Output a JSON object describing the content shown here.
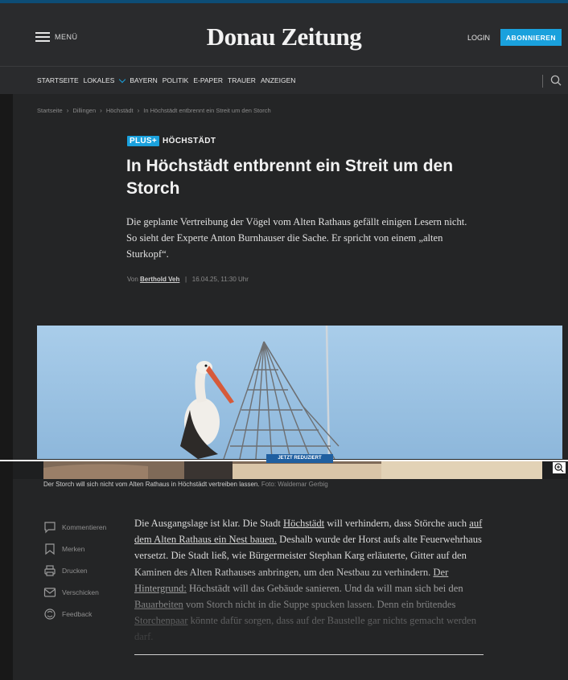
{
  "header": {
    "menu_label": "MENÜ",
    "logo": "Donau Zeitung",
    "login_label": "LOGIN",
    "subscribe_label": "ABONNIEREN",
    "accent_color": "#1aa1dd",
    "nav": [
      "STARTSEITE",
      "LOKALES",
      "BAYERN",
      "POLITIK",
      "E-PAPER",
      "TRAUER",
      "ANZEIGEN"
    ]
  },
  "breadcrumb": [
    "Startseite",
    "Dillingen",
    "Höchstädt",
    "In Höchstädt entbrennt ein Streit um den Storch"
  ],
  "article": {
    "plus_badge": "PLUS+",
    "kicker": "HÖCHSTÄDT",
    "headline": "In Höchstädt entbrennt ein Streit um den Storch",
    "lead": "Die geplante Vertreibung der Vögel vom Alten Rathaus gefällt einigen Lesern nicht. So sieht der Experte Anton Burnhauser die Sache. Er spricht von einem „alten Sturkopf“.",
    "byline_prefix": "Von",
    "author": "Berthold Veh",
    "byline_sep": "|",
    "date": "16.04.25, 11:30 Uhr",
    "image_overlay_label": "JETZT REDUZIERT",
    "caption": "Der Storch will sich nicht vom Alten Rathaus in Höchstädt vertreiben lassen.",
    "photo_credit": "Foto: Waldemar Gerbig"
  },
  "actions": [
    {
      "label": "Kommentieren",
      "icon": "comment-icon"
    },
    {
      "label": "Merken",
      "icon": "bookmark-icon"
    },
    {
      "label": "Drucken",
      "icon": "print-icon"
    },
    {
      "label": "Verschicken",
      "icon": "mail-icon"
    },
    {
      "label": "Feedback",
      "icon": "feedback-icon"
    }
  ],
  "body": {
    "t1": "Die Ausgangslage ist klar. Die Stadt ",
    "l1": "Höchstädt",
    "t2": " will verhindern, dass Störche auch ",
    "l2": "auf dem Alten Rathaus ein Nest bauen.",
    "t3": " Deshalb wurde der Horst aufs alte Feuerwehrhaus versetzt. Die Stadt ließ, wie Bürgermeister Stephan Karg erläuterte, Gitter auf den Kaminen des Alten Rathauses anbringen, um den Nestbau zu verhindern. ",
    "l3": "Der Hintergrund:",
    "t4": " Höchstädt will das Gebäude sanieren. Und da will man sich bei den ",
    "l4": "Bauarbeiten",
    "t5": " vom Storch nicht in die Suppe spucken lassen. Denn ein brütendes ",
    "l5": "Storchenpaar",
    "t6": " könnte dafür sorgen, dass auf der Baustelle gar nichts gemacht werden darf."
  }
}
